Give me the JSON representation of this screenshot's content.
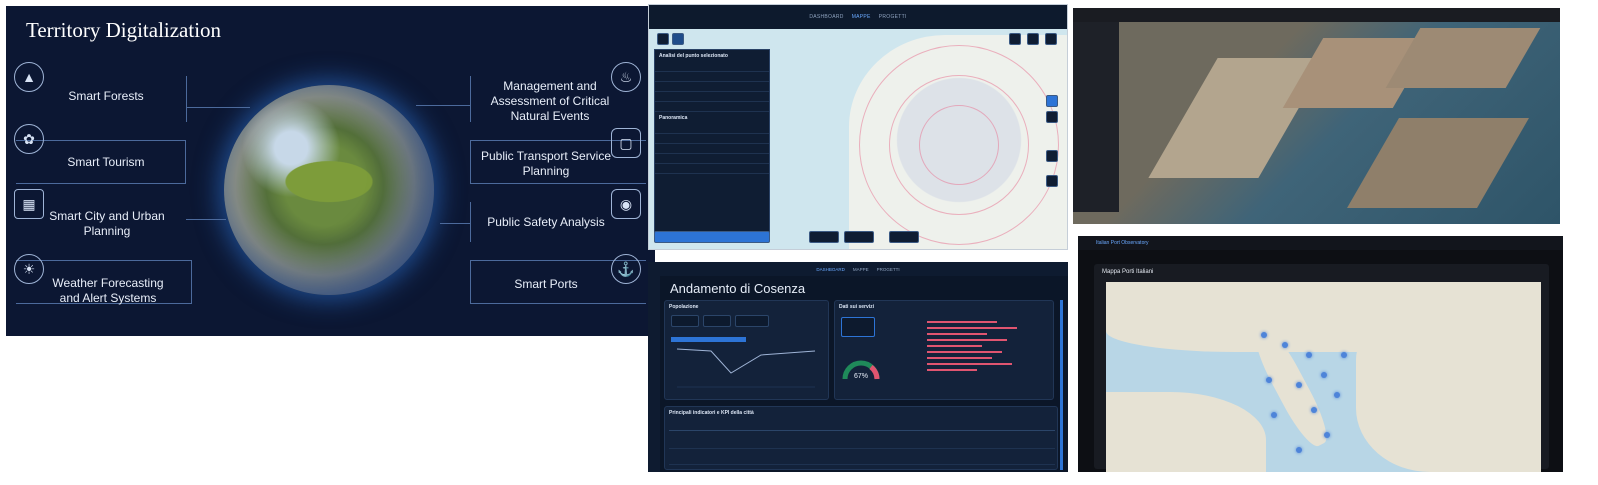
{
  "infographic": {
    "title": "Territory Digitalization",
    "left_items": [
      {
        "label": "Smart Forests",
        "icon": "forest-icon"
      },
      {
        "label": "Smart Tourism",
        "icon": "tourism-icon"
      },
      {
        "label": "Smart City and Urban Planning",
        "icon": "city-map-icon"
      },
      {
        "label": "Weather Forecasting and Alert Systems",
        "icon": "weather-icon"
      }
    ],
    "right_items": [
      {
        "label": "Management and Assessment of Critical Natural Events",
        "icon": "fire-icon"
      },
      {
        "label": "Public Transport Service Planning",
        "icon": "bus-icon"
      },
      {
        "label": "Public Safety Analysis",
        "icon": "eye-icon"
      },
      {
        "label": "Smart Ports",
        "icon": "ship-icon"
      }
    ],
    "colors": {
      "background": "#0c1733",
      "accent": "#2d74d6"
    }
  },
  "map_app": {
    "nav": [
      "DASHBOARD",
      "MAPPE",
      "PROGETTI"
    ],
    "active_nav": "MAPPE",
    "panel_title": "Analisi del punto selezionato",
    "panel_section": "Panoramica"
  },
  "dashboard": {
    "nav": [
      "DASHBOARD",
      "MAPPE",
      "PROGETTI"
    ],
    "active_nav": "DASHBOARD",
    "title": "Andamento di Cosenza",
    "population_card": "Popolazione",
    "services_card": "Dati sui servizi",
    "gauge_value": "67%",
    "table_title": "Principali indicatori e KPI della città"
  },
  "ports_app": {
    "app_title": "Italian Port Observatory",
    "card_title": "Mappa Porti Italiani",
    "colors": {
      "marker": "#4e84d9"
    }
  }
}
